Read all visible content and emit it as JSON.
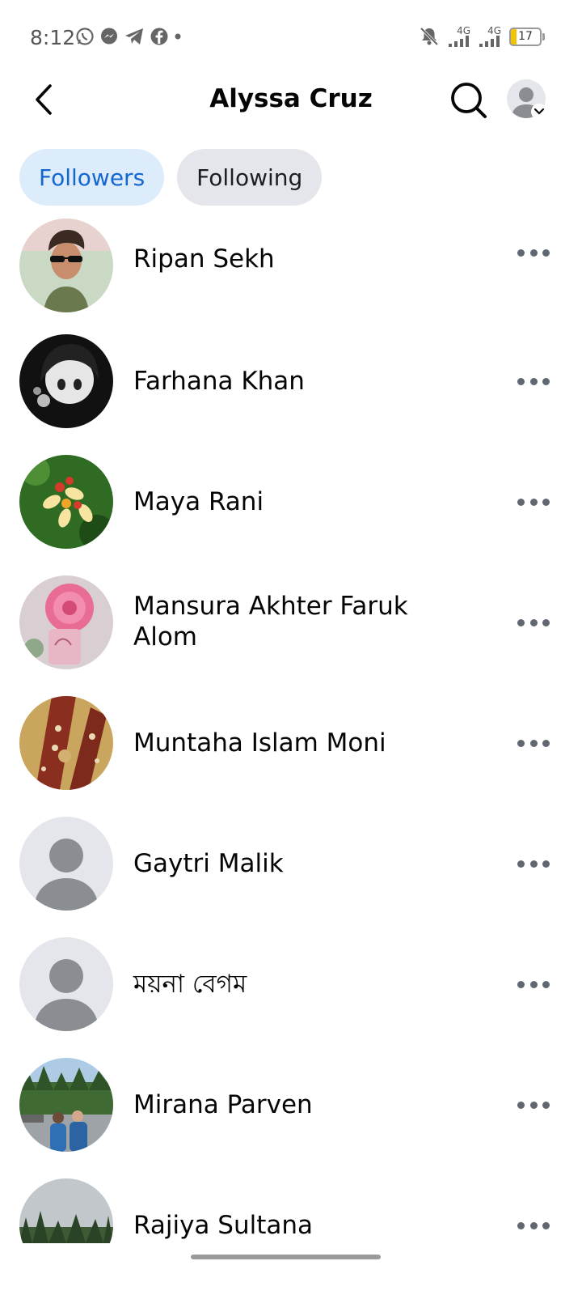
{
  "status_bar": {
    "time": "8:12",
    "battery": "17",
    "network_1": "4G",
    "network_2": "4G"
  },
  "header": {
    "title": "Alyssa Cruz"
  },
  "tabs": [
    {
      "label": "Followers",
      "active": true
    },
    {
      "label": "Following",
      "active": false
    }
  ],
  "followers": [
    {
      "name": "Ripan Sekh"
    },
    {
      "name": "Farhana Khan"
    },
    {
      "name": "Maya Rani"
    },
    {
      "name": "Mansura Akhter Faruk Alom"
    },
    {
      "name": "Muntaha Islam Moni"
    },
    {
      "name": "Gaytri Malik"
    },
    {
      "name": "ময়না বেগম"
    },
    {
      "name": "Mirana Parven"
    },
    {
      "name": "Rajiya Sultana"
    }
  ],
  "colors": {
    "accent": "#1467cf",
    "active_tab_bg": "#ddecfb",
    "inactive_tab_bg": "#e4e6eb"
  }
}
